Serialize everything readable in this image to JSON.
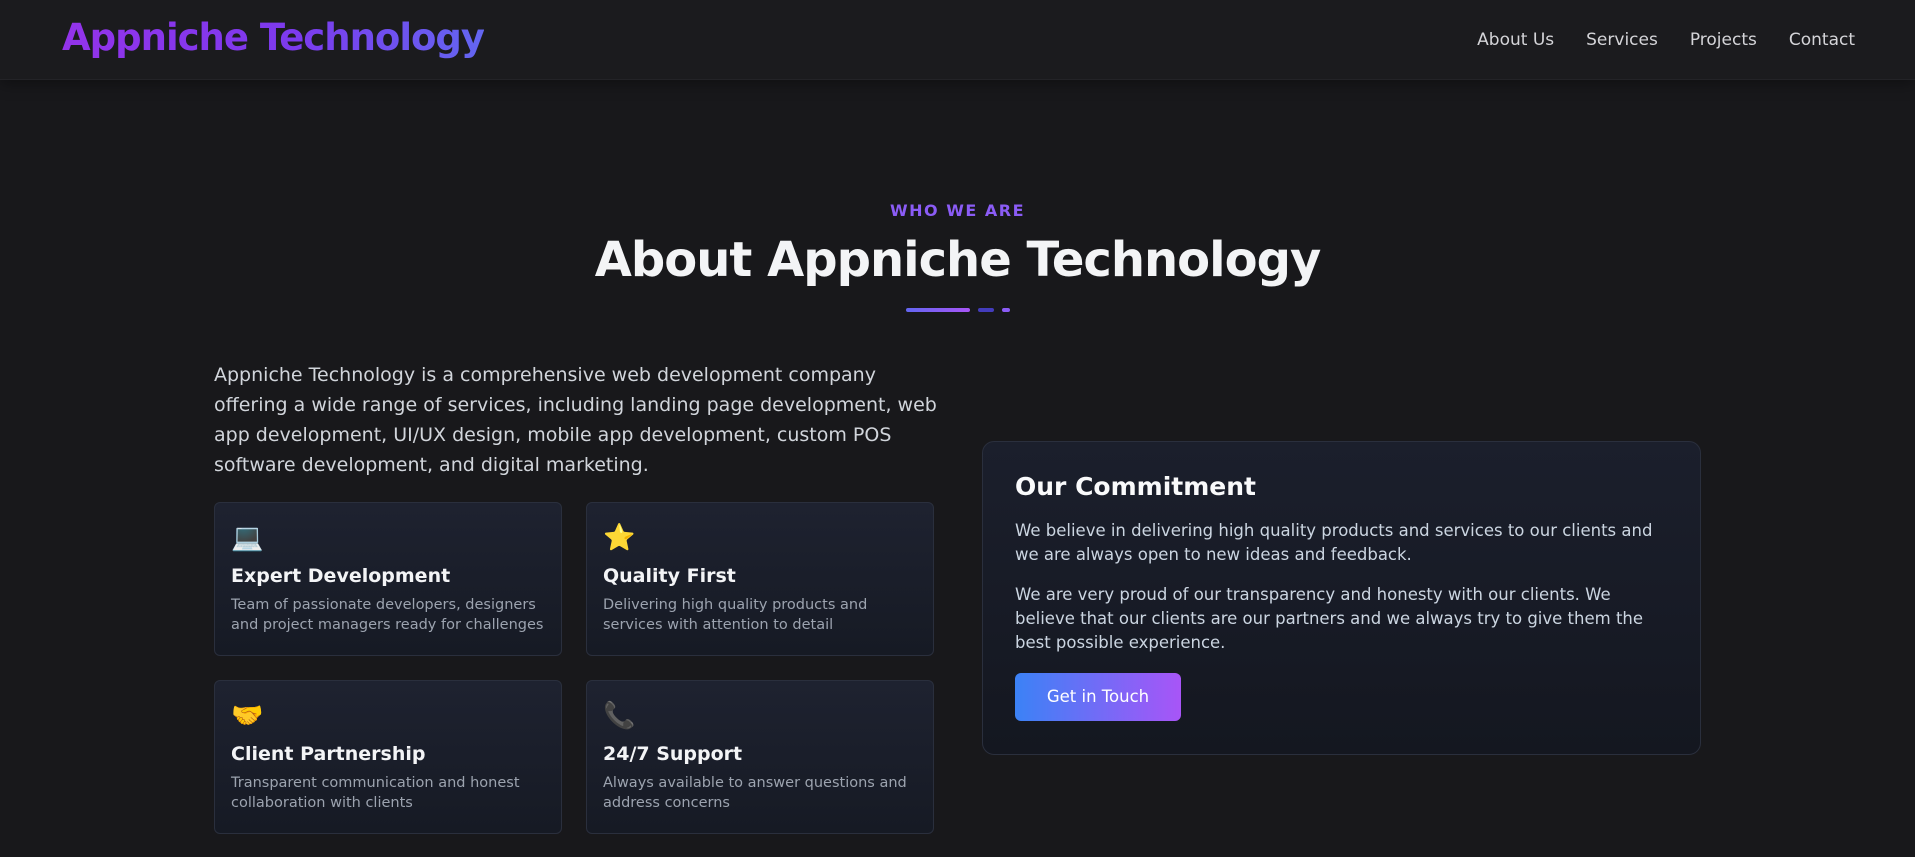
{
  "nav": {
    "logo": "Appniche Technology",
    "links": [
      "About Us",
      "Services",
      "Projects",
      "Contact"
    ]
  },
  "about": {
    "eyebrow": "WHO WE ARE",
    "title": "About Appniche Technology",
    "intro": "Appniche Technology is a comprehensive web development company offering a wide range of services, including landing page development, web app development, UI/UX design, mobile app development, custom POS software development, and digital marketing.",
    "features": [
      {
        "icon": "laptop-icon",
        "glyph": "💻",
        "title": "Expert Development",
        "desc": "Team of passionate developers, designers and project managers ready for challenges"
      },
      {
        "icon": "star-icon",
        "glyph": "⭐",
        "title": "Quality First",
        "desc": "Delivering high quality products and services with attention to detail"
      },
      {
        "icon": "handshake-icon",
        "glyph": "🤝",
        "title": "Client Partnership",
        "desc": "Transparent communication and honest collaboration with clients"
      },
      {
        "icon": "phone-icon",
        "glyph": "📞",
        "title": "24/7 Support",
        "desc": "Always available to answer questions and address concerns"
      }
    ],
    "commitment": {
      "title": "Our Commitment",
      "p1": "We believe in delivering high quality products and services to our clients and we are always open to new ideas and feedback.",
      "p2": "We are very proud of our transparency and honesty with our clients. We believe that our clients are our partners and we always try to give them the best possible experience.",
      "cta": "Get in Touch"
    }
  },
  "colors": {
    "background": "#18181b",
    "accent_purple": "#8b5cf6",
    "accent_blue": "#3b82f6",
    "card_border": "#2a2f3d"
  }
}
